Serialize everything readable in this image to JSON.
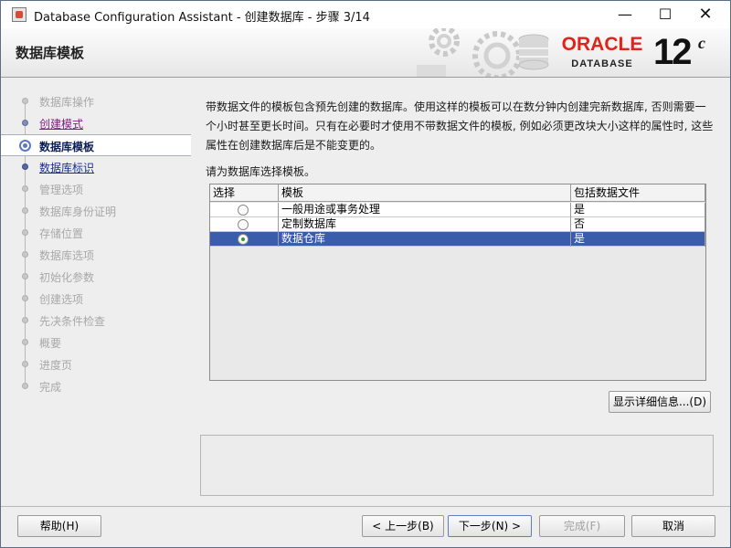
{
  "window": {
    "title": "Database Configuration Assistant - 创建数据库 - 步骤 3/14",
    "min_glyph": "—",
    "max_glyph": "☐",
    "close_glyph": "✕"
  },
  "header": {
    "page_title": "数据库模板",
    "logo_oracle": "ORACLE",
    "logo_database": "DATABASE",
    "version": "12",
    "version_suffix": "c"
  },
  "steps": [
    {
      "label": "数据库操作",
      "state": "disabled"
    },
    {
      "label": "创建模式",
      "state": "done"
    },
    {
      "label": "数据库模板",
      "state": "current"
    },
    {
      "label": "数据库标识",
      "state": "next"
    },
    {
      "label": "管理选项",
      "state": "disabled"
    },
    {
      "label": "数据库身份证明",
      "state": "disabled"
    },
    {
      "label": "存储位置",
      "state": "disabled"
    },
    {
      "label": "数据库选项",
      "state": "disabled"
    },
    {
      "label": "初始化参数",
      "state": "disabled"
    },
    {
      "label": "创建选项",
      "state": "disabled"
    },
    {
      "label": "先决条件检查",
      "state": "disabled"
    },
    {
      "label": "概要",
      "state": "disabled"
    },
    {
      "label": "进度页",
      "state": "disabled"
    },
    {
      "label": "完成",
      "state": "disabled"
    }
  ],
  "content": {
    "description": "带数据文件的模板包含预先创建的数据库。使用这样的模板可以在数分钟内创建完新数据库, 否则需要一个小时甚至更长时间。只有在必要时才使用不带数据文件的模板, 例如必须更改块大小这样的属性时, 这些属性在创建数据库后是不能变更的。",
    "prompt": "请为数据库选择模板。",
    "table": {
      "headers": [
        "选择",
        "模板",
        "包括数据文件"
      ],
      "rows": [
        {
          "template": "一般用途或事务处理",
          "datafiles": "是",
          "selected": false
        },
        {
          "template": "定制数据库",
          "datafiles": "否",
          "selected": false
        },
        {
          "template": "数据仓库",
          "datafiles": "是",
          "selected": true
        }
      ]
    },
    "details_button": "显示详细信息...(D)"
  },
  "buttons": {
    "help": "帮助(H)",
    "back": "< 上一步(B)",
    "next": "下一步(N) >",
    "finish": "完成(F)",
    "cancel": "取消"
  }
}
